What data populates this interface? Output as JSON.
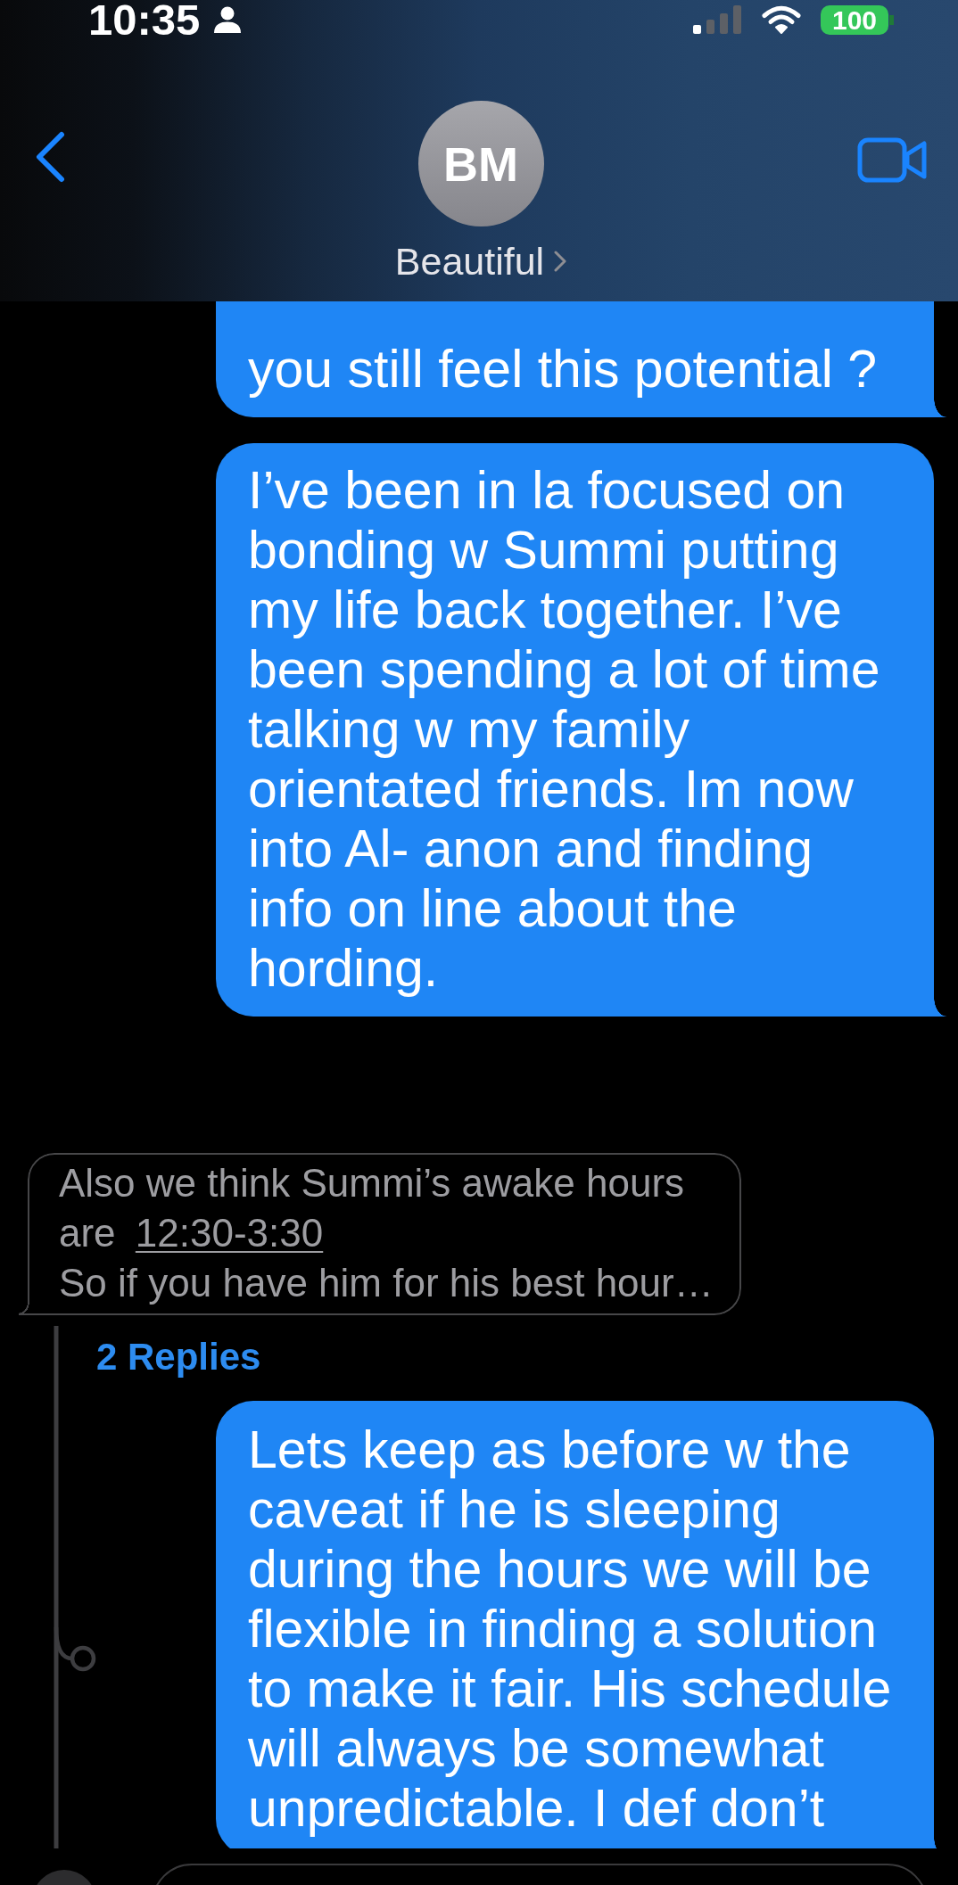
{
  "status_bar": {
    "time": "10:35",
    "battery": "100"
  },
  "header": {
    "avatar_initials": "BM",
    "contact_name": "Beautiful"
  },
  "messages": [
    {
      "kind": "sent",
      "text": "you still feel this potential ?"
    },
    {
      "kind": "sent",
      "text": "I’ve been in la focused on bonding w Summi putting my life back together. I’ve been spending a lot of time talking w my family orientated friends. Im now into Al- anon and finding info on line about the hording."
    }
  ],
  "thread": {
    "quoted_message": {
      "paragraphs": [
        {
          "text": "Also we think Summi’s awake hours are",
          "link": "12:30-3:30"
        },
        {
          "text": "So if you have him for his best hour…"
        }
      ]
    },
    "replies_label": "2 Replies",
    "messages": [
      {
        "kind": "sent",
        "text": "Lets keep as before w the caveat if he is sleeping during the hours we will be flexible in finding a solution to make it fair. His schedule will always be somewhat unpredictable. I def don’t"
      }
    ]
  }
}
